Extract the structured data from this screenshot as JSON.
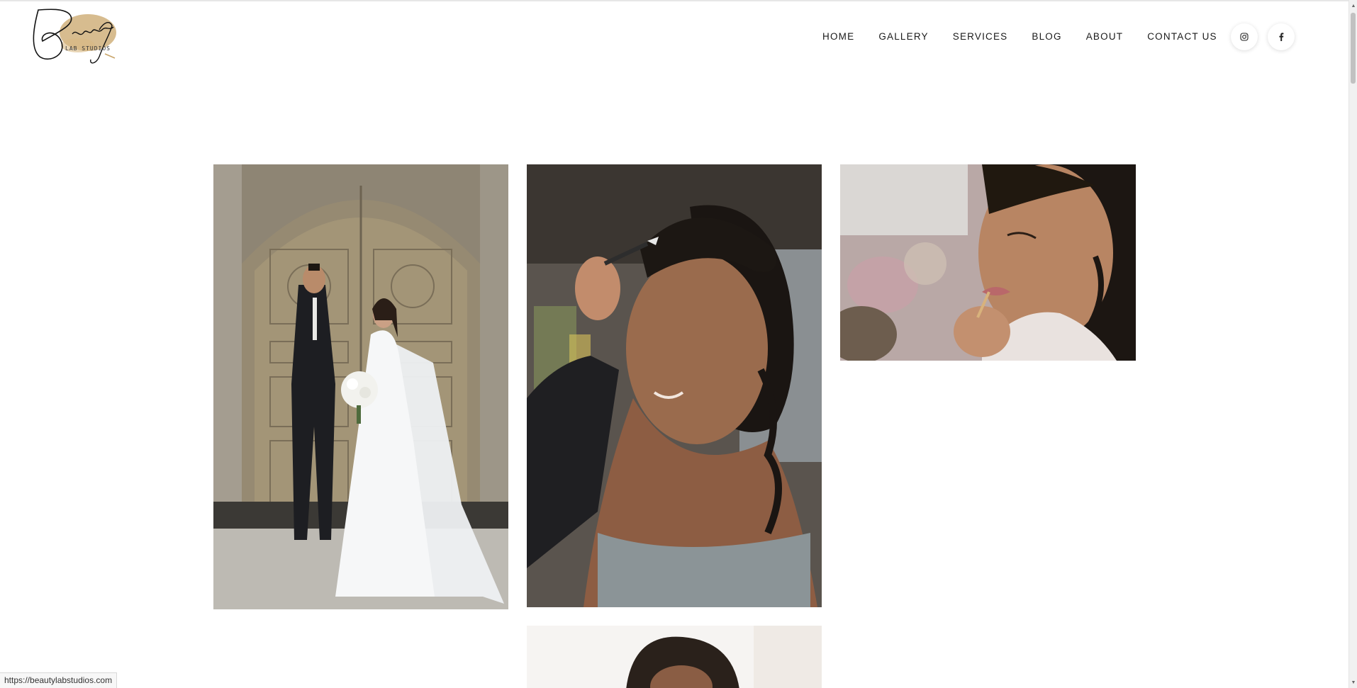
{
  "brand": {
    "logo_alt": "Beauty Lab Studios",
    "logo_script": "Beauty",
    "logo_sub": "LAB STUDIOS"
  },
  "nav": {
    "items": [
      {
        "label": "HOME"
      },
      {
        "label": "GALLERY"
      },
      {
        "label": "SERVICES"
      },
      {
        "label": "BLOG"
      },
      {
        "label": "ABOUT"
      },
      {
        "label": "CONTACT US"
      }
    ]
  },
  "social": [
    {
      "icon": "instagram-icon"
    },
    {
      "icon": "facebook-icon"
    }
  ],
  "gallery": {
    "images": [
      {
        "subject": "bride-and-groom-at-church-doors"
      },
      {
        "subject": "woman-getting-makeup-applied"
      },
      {
        "subject": "woman-applying-lip-color"
      },
      {
        "subject": "woman-portrait-partially-visible"
      }
    ]
  },
  "status_bar": {
    "url": "https://beautylabstudios.com"
  },
  "colors": {
    "accent_gold": "#c9a56a",
    "text_dark": "#1a1a1a"
  }
}
